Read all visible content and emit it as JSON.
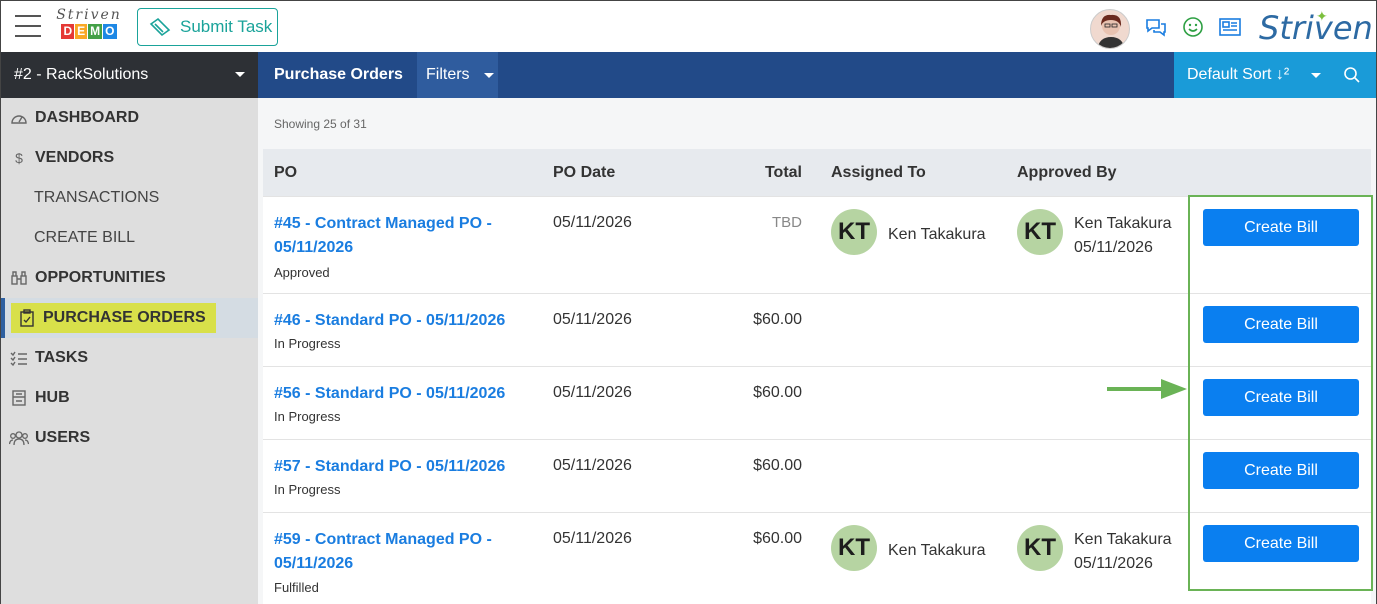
{
  "header": {
    "logo_small_script": "Striven",
    "logo_small_demo": [
      "D",
      "E",
      "M",
      "O"
    ],
    "demo_colors": [
      "#e53935",
      "#f9a825",
      "#43a047",
      "#1e88e5"
    ],
    "submit_task_label": "Submit Task",
    "brand_name": "Striven"
  },
  "company": {
    "name": "#2 - RackSolutions"
  },
  "navbar": {
    "title": "Purchase Orders",
    "filters_label": "Filters",
    "sort_label": "Default Sort ↓²"
  },
  "sidebar": {
    "items": [
      {
        "label": "DASHBOARD",
        "type": "main",
        "icon": "dashboard-icon"
      },
      {
        "label": "VENDORS",
        "type": "main",
        "icon": "dollar-icon"
      },
      {
        "label": "TRANSACTIONS",
        "type": "sub"
      },
      {
        "label": "CREATE BILL",
        "type": "sub"
      },
      {
        "label": "OPPORTUNITIES",
        "type": "main",
        "icon": "binoculars-icon"
      },
      {
        "label": "PURCHASE ORDERS",
        "type": "main",
        "icon": "clipboard-icon",
        "active": true
      },
      {
        "label": "TASKS",
        "type": "main",
        "icon": "tasks-icon"
      },
      {
        "label": "HUB",
        "type": "main",
        "icon": "hub-icon"
      },
      {
        "label": "USERS",
        "type": "main",
        "icon": "users-icon"
      }
    ]
  },
  "content": {
    "showing": "Showing 25 of 31",
    "columns": {
      "po": "PO",
      "po_date": "PO Date",
      "total": "Total",
      "assigned_to": "Assigned To",
      "approved_by": "Approved By"
    },
    "rows": [
      {
        "po_line1": "#45 - Contract Managed PO -",
        "po_line2": "05/11/2026",
        "status": "Approved",
        "date": "05/11/2026",
        "total": "TBD",
        "assigned_initials": "KT",
        "assigned_name": "Ken Takakura",
        "approved_initials": "KT",
        "approved_name": "Ken Takakura",
        "approved_date": "05/11/2026",
        "button": "Create Bill"
      },
      {
        "po_line1": "#46 - Standard PO - 05/11/2026",
        "po_line2": "",
        "status": "In Progress",
        "date": "05/11/2026",
        "total": "$60.00",
        "button": "Create Bill"
      },
      {
        "po_line1": "#56 - Standard PO - 05/11/2026",
        "po_line2": "",
        "status": "In Progress",
        "date": "05/11/2026",
        "total": "$60.00",
        "button": "Create Bill"
      },
      {
        "po_line1": "#57 - Standard PO - 05/11/2026",
        "po_line2": "",
        "status": "In Progress",
        "date": "05/11/2026",
        "total": "$60.00",
        "button": "Create Bill"
      },
      {
        "po_line1": "#59 - Contract Managed PO -",
        "po_line2": "05/11/2026",
        "status": "Fulfilled",
        "date": "05/11/2026",
        "total": "$60.00",
        "assigned_initials": "KT",
        "assigned_name": "Ken Takakura",
        "approved_initials": "KT",
        "approved_name": "Ken Takakura",
        "approved_date": "05/11/2026",
        "button": "Create Bill"
      }
    ]
  }
}
